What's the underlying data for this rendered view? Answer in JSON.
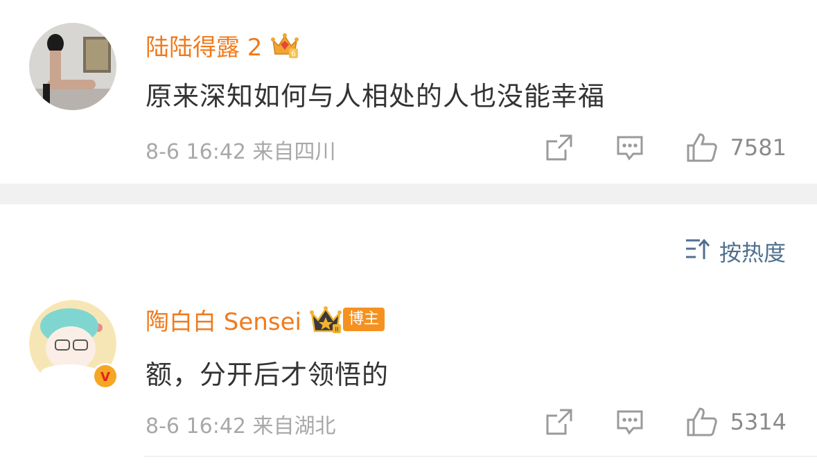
{
  "comments": [
    {
      "username": "陆陆得露 2",
      "level_badge": "6",
      "text": "原来深知如何与人相处的人也没能幸福",
      "meta": "8-6 16:42  来自四川",
      "likes": "7581"
    },
    {
      "username": "陶白白 Sensei",
      "level_badge": "II",
      "badge_label": "博主",
      "verified_mark": "V",
      "text": "额，分开后才领悟的",
      "meta": "8-6 16:42  来自湖北",
      "likes": "5314"
    }
  ],
  "sort": {
    "label": "按热度"
  },
  "colors": {
    "username": "#f07a1c",
    "sort": "#4f6f8f",
    "meta": "#a8a8a8"
  },
  "icons": [
    "share-icon",
    "reply-icon",
    "like-icon",
    "sort-icon",
    "crown-icon",
    "verified-icon"
  ]
}
